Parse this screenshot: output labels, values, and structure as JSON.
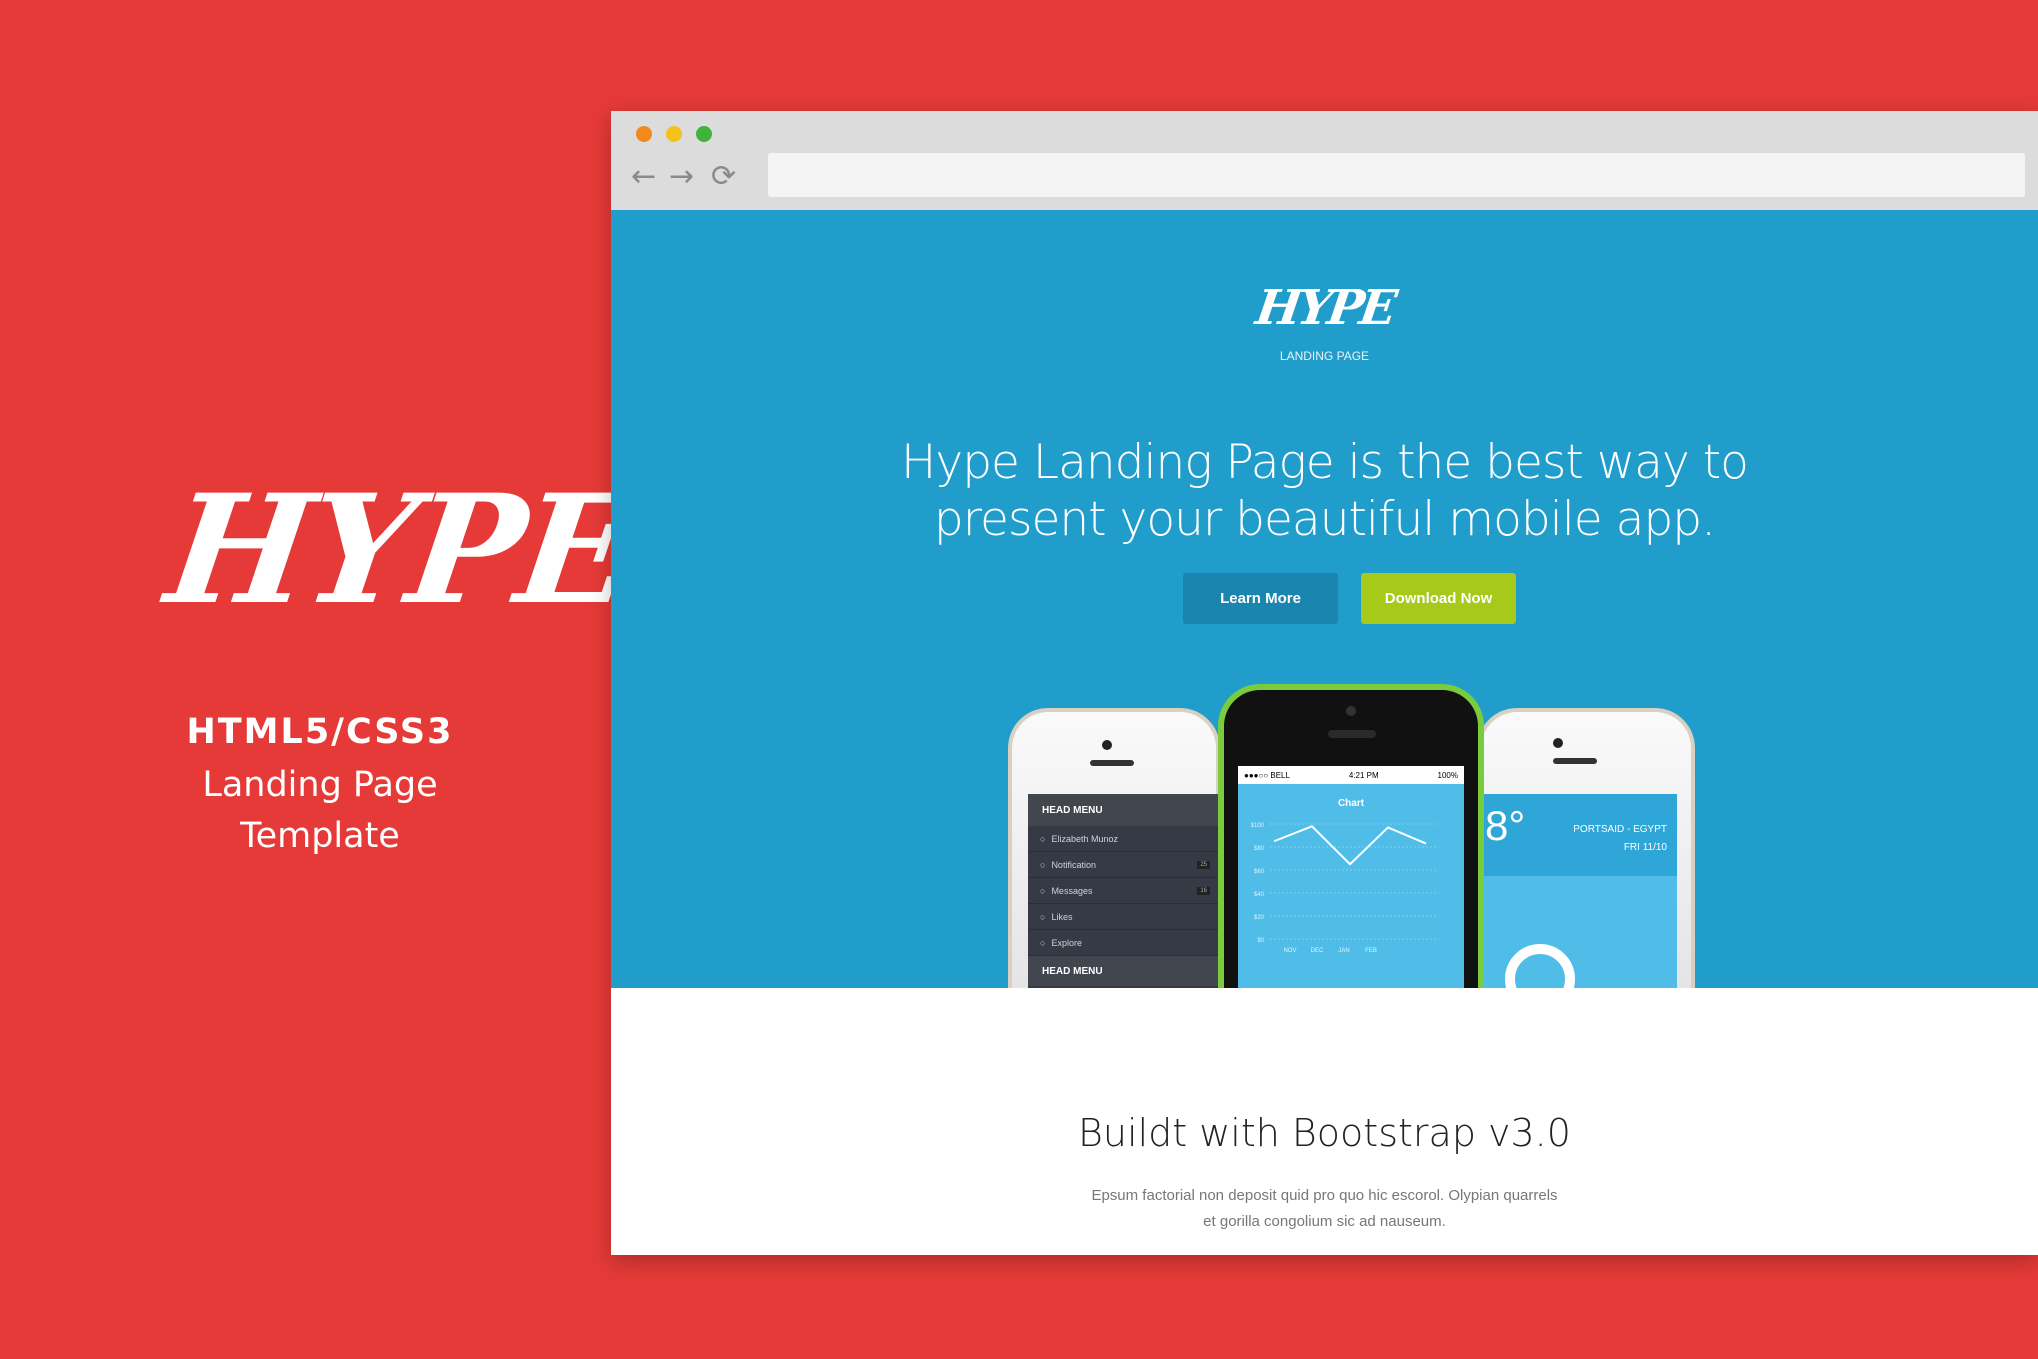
{
  "colors": {
    "background": "#e53a37",
    "hero": "#219dcc",
    "learn_more": "#1a86b0",
    "download": "#a6c91a"
  },
  "left": {
    "logo": "HYPE",
    "line1": "HTML5/CSS3",
    "line2": "Landing Page",
    "line3": "Template"
  },
  "browser": {
    "back_icon": "←",
    "forward_icon": "→",
    "reload_icon": "⟳",
    "address": ""
  },
  "hero": {
    "logo": "HYPE",
    "logo_sub": "LANDING PAGE",
    "headline1": "Hype Landing Page is the best way to",
    "headline2": "present your beautiful mobile app.",
    "learn_more": "Learn More",
    "download": "Download Now"
  },
  "phones": {
    "left": {
      "header": "HEAD MENU",
      "items": [
        {
          "label": "Elizabeth Munoz",
          "badge": ""
        },
        {
          "label": "Notification",
          "badge": "25"
        },
        {
          "label": "Messages",
          "badge": "16"
        },
        {
          "label": "Likes",
          "badge": ""
        },
        {
          "label": "Explore",
          "badge": ""
        }
      ],
      "footer": "HEAD MENU"
    },
    "center": {
      "carrier": "●●●○○ BELL",
      "time": "4:21 PM",
      "battery": "100%",
      "chart_title": "Chart",
      "y_ticks": [
        "$100",
        "$80",
        "$60",
        "$40",
        "$20",
        "$0"
      ],
      "x_ticks": [
        "NOV",
        "DEC",
        "JAN",
        "FEB"
      ],
      "values": [
        85,
        98,
        65,
        97,
        83
      ]
    },
    "right": {
      "temp": "8°",
      "location": "PORTSAID - EGYPT",
      "date": "FRI  11/10"
    }
  },
  "section": {
    "title": "Buildt with Bootstrap v3.0",
    "para1": "Epsum factorial non deposit quid pro quo hic escorol. Olypian quarrels",
    "para2": "et gorilla congolium sic ad nauseum."
  }
}
